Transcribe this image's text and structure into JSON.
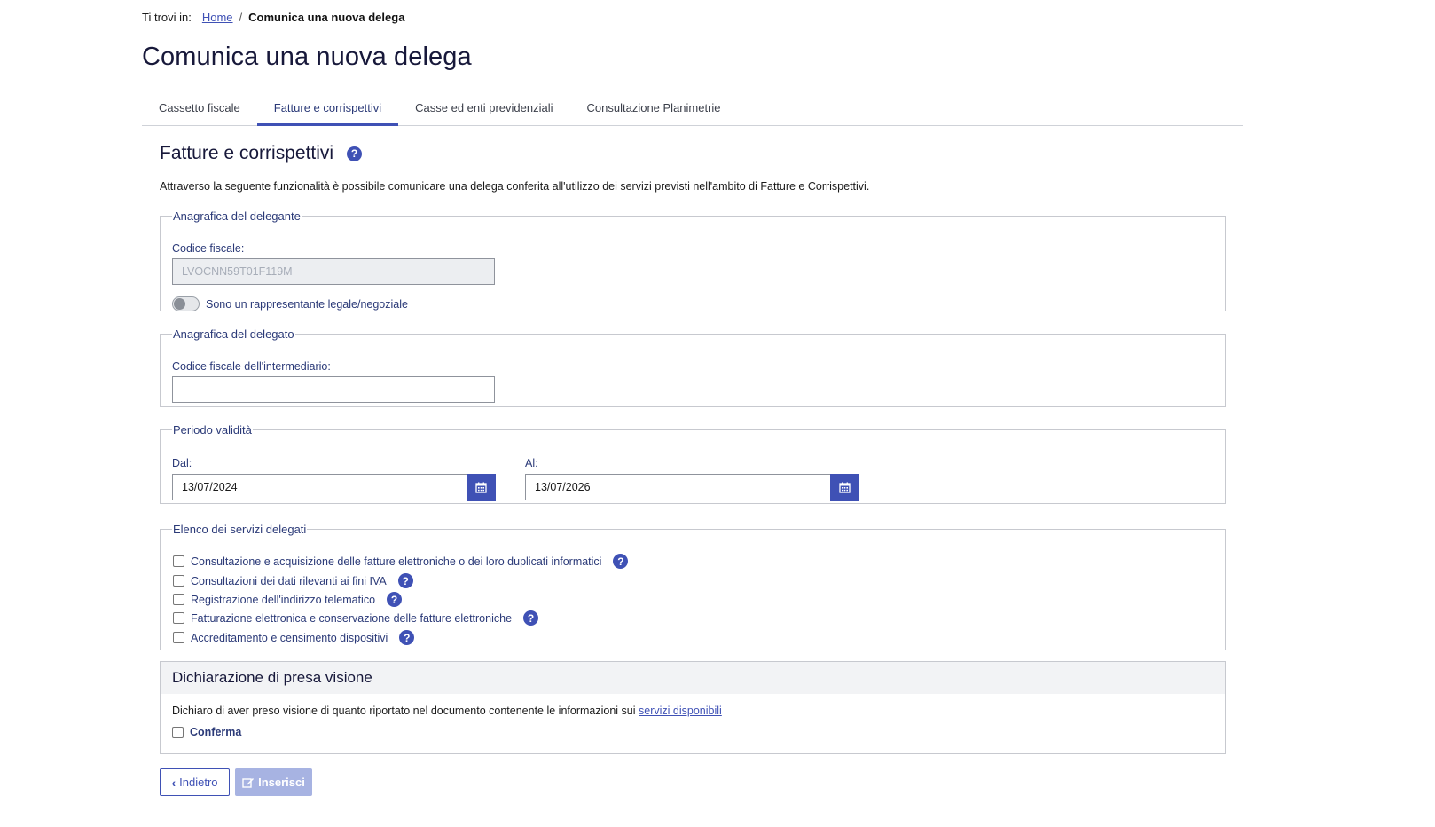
{
  "breadcrumb": {
    "prefix": "Ti trovi in:",
    "home": "Home",
    "separator": "/",
    "current": "Comunica una nuova delega"
  },
  "page_title": "Comunica una nuova delega",
  "tabs": [
    {
      "label": "Cassetto fiscale",
      "active": false
    },
    {
      "label": "Fatture e corrispettivi",
      "active": true
    },
    {
      "label": "Casse ed enti previdenziali",
      "active": false
    },
    {
      "label": "Consultazione Planimetrie",
      "active": false
    }
  ],
  "section": {
    "title": "Fatture e corrispettivi",
    "help_icon": "question-circle-icon",
    "intro": "Attraverso la seguente funzionalità è possibile comunicare una delega conferita all'utilizzo dei servizi previsti nell'ambito di Fatture e Corrispettivi."
  },
  "delegante": {
    "legend": "Anagrafica del delegante",
    "cf_label": "Codice fiscale:",
    "cf_value": "LVOCNN59T01F119M",
    "toggle_label": "Sono un rappresentante legale/negoziale",
    "toggle_on": false
  },
  "delegato": {
    "legend": "Anagrafica del delegato",
    "cf_label": "Codice fiscale dell'intermediario:",
    "cf_value": ""
  },
  "periodo": {
    "legend": "Periodo validità",
    "dal_label": "Dal:",
    "dal_value": "13/07/2024",
    "al_label": "Al:",
    "al_value": "13/07/2026",
    "calendar_icon": "calendar-icon"
  },
  "servizi": {
    "legend": "Elenco dei servizi delegati",
    "items": [
      {
        "label": "Consultazione e acquisizione delle fatture elettroniche o dei loro duplicati informatici",
        "checked": false
      },
      {
        "label": "Consultazioni dei dati rilevanti ai fini IVA",
        "checked": false
      },
      {
        "label": "Registrazione dell'indirizzo telematico",
        "checked": false
      },
      {
        "label": "Fatturazione elettronica e conservazione delle fatture elettroniche",
        "checked": false
      },
      {
        "label": "Accreditamento e censimento dispositivi",
        "checked": false
      }
    ]
  },
  "dichiarazione": {
    "title": "Dichiarazione di presa visione",
    "text": "Dichiaro di aver preso visione di quanto riportato nel documento contenente le informazioni sui",
    "link": "servizi disponibili",
    "confirm_label": "Conferma",
    "confirmed": false
  },
  "buttons": {
    "back": "Indietro",
    "insert": "Inserisci",
    "insert_disabled": true
  },
  "colors": {
    "accent": "#3f51b5",
    "title": "#17183a",
    "label": "#2b3a78",
    "border": "#c7c9cf",
    "disabled_button": "#a7b3e2"
  }
}
